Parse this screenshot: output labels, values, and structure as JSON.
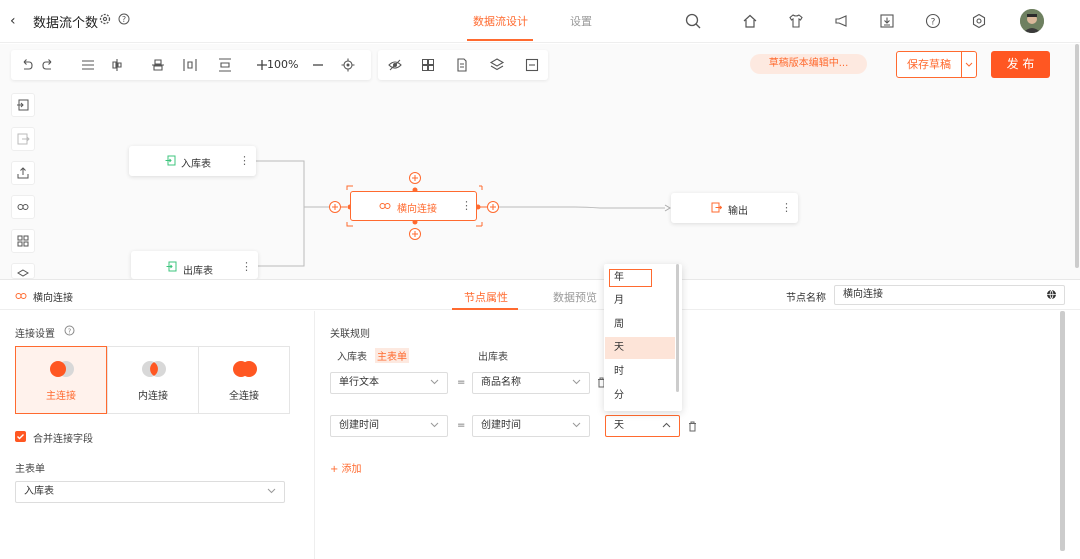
{
  "header": {
    "title": "数据流个数",
    "tabs": [
      {
        "label": "数据流设计",
        "active": true
      },
      {
        "label": "设置",
        "active": false
      }
    ],
    "icons": [
      "search-icon",
      "home-icon",
      "shirt-icon",
      "megaphone-icon",
      "download-icon",
      "help-icon",
      "settings-icon"
    ]
  },
  "toolbar": {
    "zoom": "100%"
  },
  "actions": {
    "draft_status": "草稿版本编辑中...",
    "save_draft": "保存草稿",
    "publish": "发 布"
  },
  "nodes": {
    "in_table": "入库表",
    "out_table": "出库表",
    "join": "横向连接",
    "output": "输出"
  },
  "panel": {
    "node_type": "横向连接",
    "tabs": [
      {
        "label": "节点属性",
        "active": true
      },
      {
        "label": "数据预览",
        "active": false
      }
    ],
    "node_name_label": "节点名称",
    "node_name_value": "横向连接",
    "join_settings_label": "连接设置",
    "join_types": [
      {
        "label": "主连接",
        "active": true
      },
      {
        "label": "内连接",
        "active": false
      },
      {
        "label": "全连接",
        "active": false
      }
    ],
    "merge_fields_label": "合并连接字段",
    "main_table_label": "主表单",
    "main_table_value": "入库表",
    "rules_label": "关联规则",
    "left_table": "入库表",
    "left_table_tag": "主表单",
    "right_table": "出库表",
    "rules": [
      {
        "left": "单行文本",
        "eq": "=",
        "right": "商品名称"
      },
      {
        "left": "创建时间",
        "eq": "=",
        "right": "创建时间",
        "unit": "天"
      }
    ],
    "add_label": "+ 添加"
  },
  "dropdown": {
    "options": [
      "年",
      "月",
      "周",
      "天",
      "时",
      "分"
    ],
    "selected": "天"
  },
  "colors": {
    "accent": "#ff6a2f",
    "publish": "#ff5722",
    "input_node": "#3cc47c"
  }
}
